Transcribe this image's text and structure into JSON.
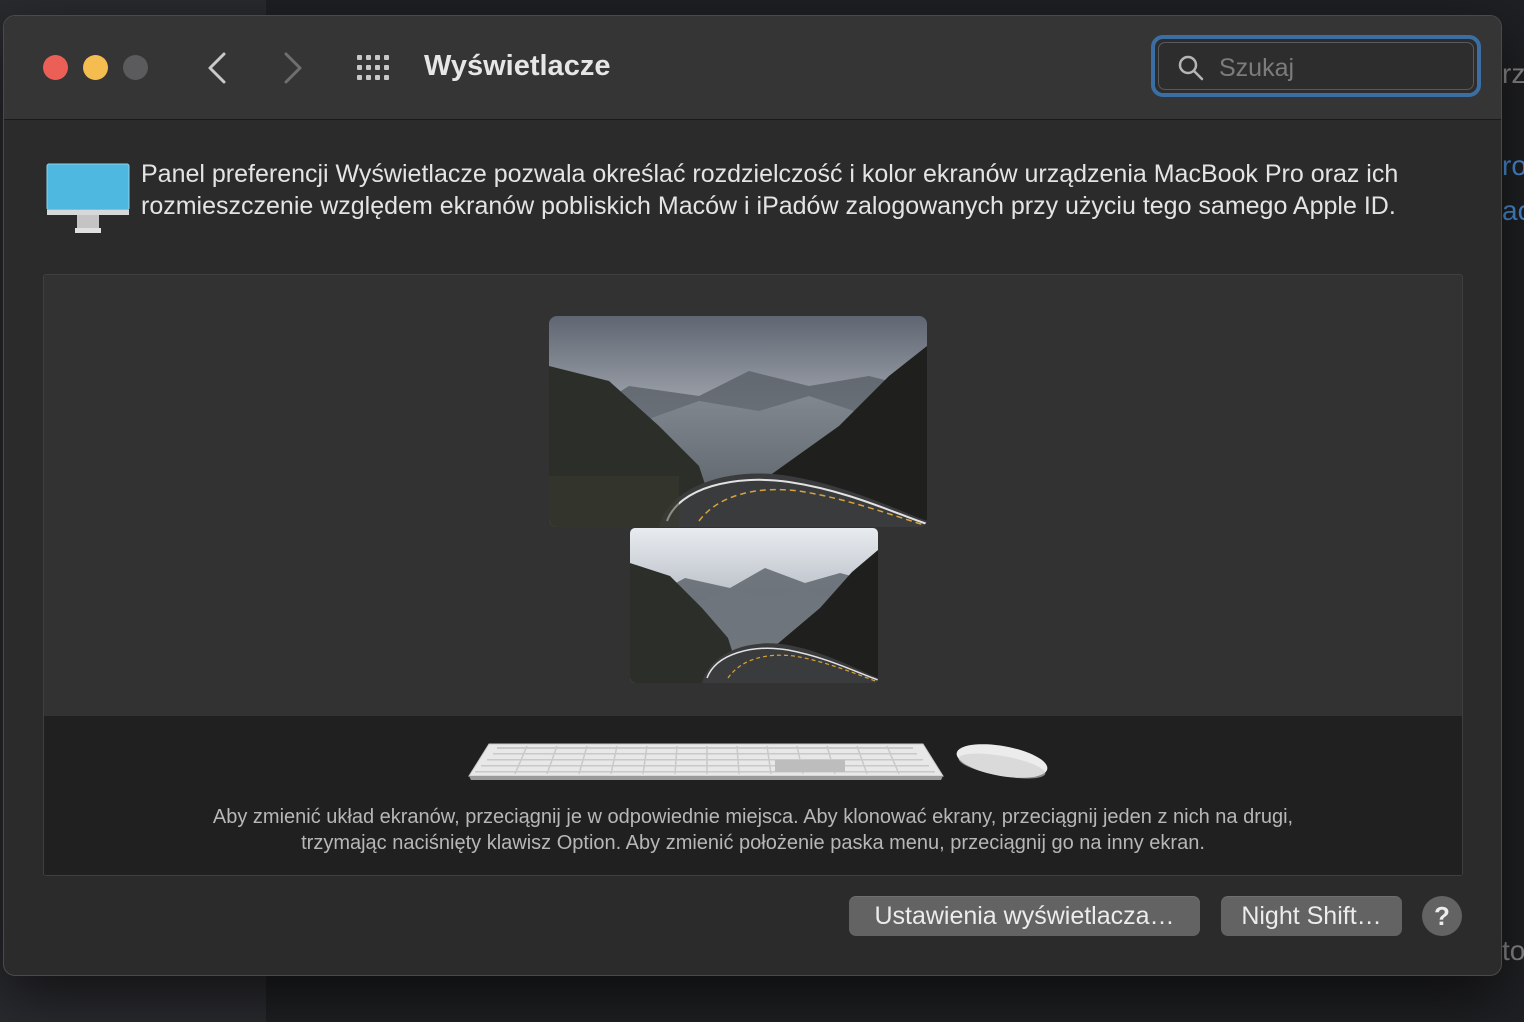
{
  "window": {
    "title": "Wyświetlacze",
    "search": {
      "placeholder": "Szukaj",
      "value": ""
    }
  },
  "intro_text": "Panel preferencji Wyświetlacze pozwala określać rozdzielczość i kolor ekranów urządzenia MacBook Pro oraz ich rozmieszczenie względem ekranów pobliskich Maców i iPadów zalogowanych przy użyciu tego samego Apple ID.",
  "arrangement": {
    "instructions_line1": "Aby zmienić układ ekranów, przeciągnij je w odpowiednie miejsca. Aby klonować ekrany, przeciągnij jeden z nich na drugi,",
    "instructions_line2": "trzymając naciśnięty klawisz Option. Aby zmienić położenie paska menu, przeciągnij go na inny ekran."
  },
  "buttons": {
    "display_settings": "Ustawienia wyświetlacza…",
    "night_shift": "Night Shift…",
    "help": "?"
  },
  "background_fragments": {
    "frag1": "rz",
    "frag2": "ro",
    "frag3": "ac",
    "frag4": "to"
  },
  "colors": {
    "close": "#ec5f57",
    "minimize": "#f5bd4f",
    "search_focus": "#3b6fa3",
    "monitor_icon": "#4fb8e0"
  }
}
